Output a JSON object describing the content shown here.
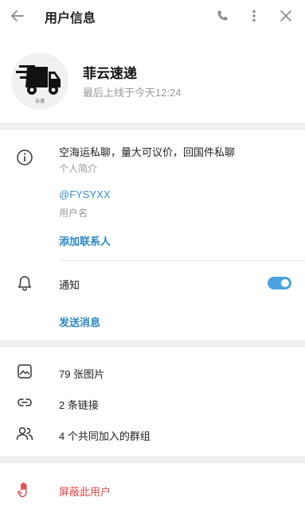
{
  "header": {
    "title": "用户信息",
    "back_icon": "arrow-left-icon",
    "call_icon": "phone-icon",
    "more_icon": "more-vertical-icon",
    "close_icon": "close-icon"
  },
  "profile": {
    "name": "菲云速递",
    "status": "最后上线于今天12:24",
    "avatar_text": "云速"
  },
  "info": {
    "bio": "空海运私聊，量大可议价，回国件私聊",
    "bio_label": "个人简介",
    "username": "@FYSYXX",
    "username_label": "用户名",
    "add_contact": "添加联系人"
  },
  "notifications": {
    "label": "通知",
    "enabled": true,
    "send_message": "发送消息"
  },
  "media": {
    "photos": "79 张图片",
    "links": "2 条链接",
    "groups": "4 个共同加入的群组"
  },
  "block": {
    "label": "屏蔽此用户"
  },
  "colors": {
    "accent": "#2a88c8",
    "danger": "#e0484b",
    "toggle": "#4aa3df"
  }
}
